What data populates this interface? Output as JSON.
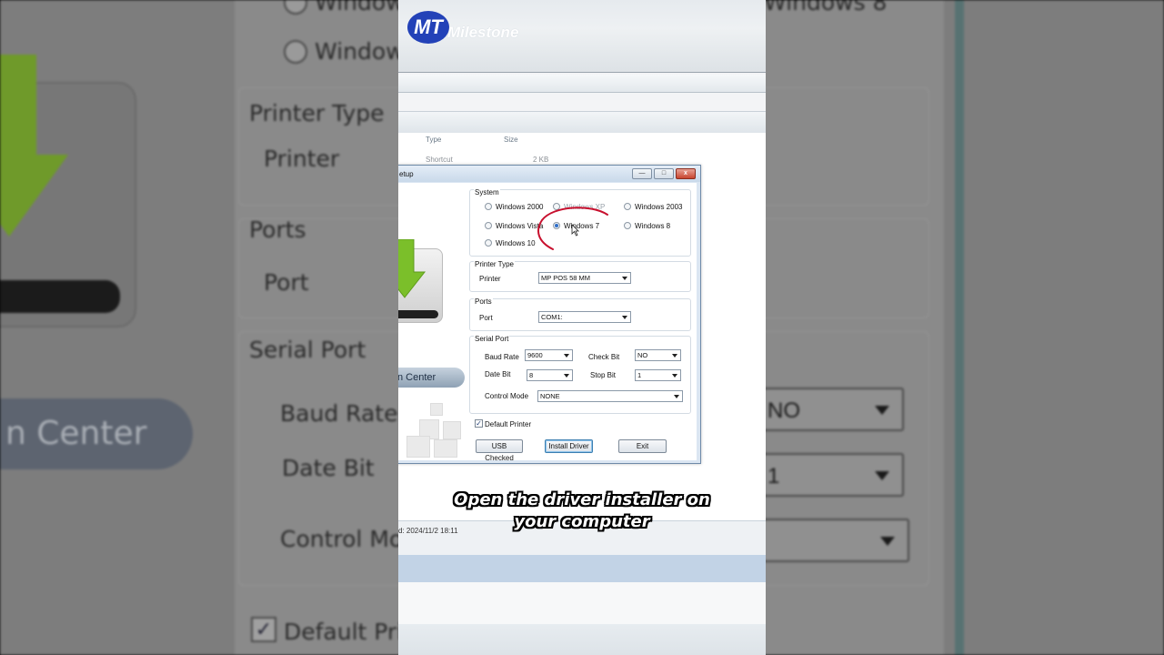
{
  "background": {
    "labels": {
      "windows_top": "Windows",
      "windows": "Windows",
      "windows8_top": "Windows 8",
      "printer_type": "Printer Type",
      "printer": "Printer",
      "ports": "Ports",
      "port": "Port",
      "serial_port": "Serial Port",
      "baud_rate": "Baud Rate",
      "date_bit": "Date Bit",
      "control_mode": "Control Mod",
      "default_printer": "Default Prin",
      "center_pill": "n Center",
      "check_value": "NO",
      "stop_value": "1"
    }
  },
  "brand": {
    "name": "Milestone",
    "mark": "MT"
  },
  "explorer": {
    "columns": [
      "Type",
      "Size"
    ],
    "row": {
      "type": "Shortcut",
      "size": "2 KB"
    },
    "status_date": "d: 2024/11/2 18:11"
  },
  "dialog": {
    "title": "etup",
    "titlebar_buttons": {
      "minimize": "—",
      "maximize": "□",
      "close": "x"
    },
    "left_pill": "n Center",
    "system": {
      "title": "System",
      "options": [
        {
          "label": "Windows 2000",
          "checked": false,
          "enabled": true
        },
        {
          "label": "Windows XP",
          "checked": false,
          "enabled": false
        },
        {
          "label": "Windows 2003",
          "checked": false,
          "enabled": true
        },
        {
          "label": "Windows Vista",
          "checked": false,
          "enabled": true
        },
        {
          "label": "Windows 7",
          "checked": true,
          "enabled": true
        },
        {
          "label": "Windows 8",
          "checked": false,
          "enabled": true
        },
        {
          "label": "Windows 10",
          "checked": false,
          "enabled": true
        }
      ]
    },
    "printer_type": {
      "title": "Printer Type",
      "printer_label": "Printer",
      "printer_value": "MP POS 58 MM"
    },
    "ports": {
      "title": "Ports",
      "port_label": "Port",
      "port_value": "COM1:"
    },
    "serial_port": {
      "title": "Serial Port",
      "baud_rate_label": "Baud Rate",
      "baud_rate_value": "9600",
      "check_bit_label": "Check Bit",
      "check_bit_value": "NO",
      "date_bit_label": "Date Bit",
      "date_bit_value": "8",
      "stop_bit_label": "Stop Bit",
      "stop_bit_value": "1",
      "control_mode_label": "Control Mode",
      "control_mode_value": "NONE"
    },
    "default_printer": {
      "label": "Default Printer",
      "checked": true,
      "check_glyph": "✓"
    },
    "buttons": {
      "usb_checked": "USB Checked",
      "install_driver": "Install Driver",
      "exit": "Exit"
    }
  },
  "caption": {
    "line1": "Open the driver installer on",
    "line2": "your computer"
  },
  "colors": {
    "annotation": "#c8102e",
    "brand_blue": "#2342b8",
    "arrow_green": "#7bbf2a"
  }
}
